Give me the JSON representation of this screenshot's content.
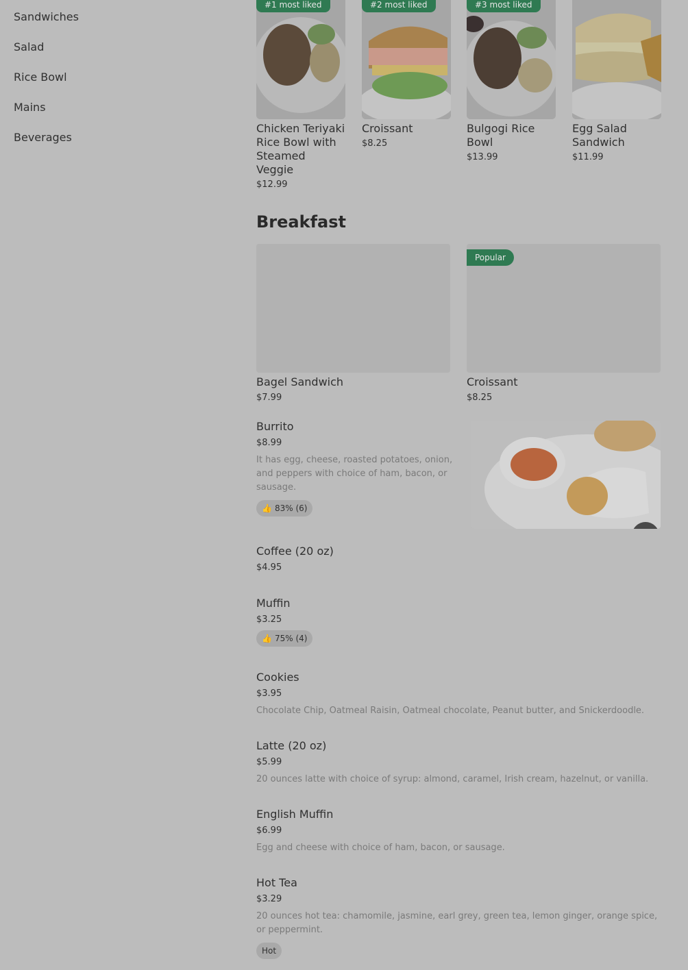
{
  "sidebar": {
    "items": [
      {
        "label": "Sandwiches"
      },
      {
        "label": "Salad"
      },
      {
        "label": "Rice Bowl"
      },
      {
        "label": "Mains"
      },
      {
        "label": "Beverages"
      }
    ]
  },
  "most_liked": [
    {
      "badge": "#1 most liked",
      "name": "Chicken Teriyaki Rice Bowl with Steamed Veggie",
      "price": "$12.99"
    },
    {
      "badge": "#2 most liked",
      "name": "Croissant",
      "price": "$8.25"
    },
    {
      "badge": "#3 most liked",
      "name": "Bulgogi Rice Bowl",
      "price": "$13.99"
    },
    {
      "badge": "",
      "name": "Egg Salad Sandwich",
      "price": "$11.99"
    }
  ],
  "breakfast": {
    "title": "Breakfast",
    "featured": [
      {
        "badge": "",
        "name": "Bagel Sandwich",
        "price": "$7.99"
      },
      {
        "badge": "Popular",
        "name": "Croissant",
        "price": "$8.25"
      }
    ],
    "items": [
      {
        "name": "Burrito",
        "price": "$8.99",
        "desc": "It has egg, cheese, roasted potatoes, onion, and peppers with choice of ham, bacon, or sausage.",
        "rating": "83% (6)"
      },
      {
        "name": "Coffee (20 oz)",
        "price": "$4.95"
      },
      {
        "name": "Muffin",
        "price": "$3.25",
        "rating": "75% (4)"
      },
      {
        "name": "Cookies",
        "price": "$3.95",
        "desc": "Chocolate Chip, Oatmeal Raisin, Oatmeal chocolate, Peanut butter, and Snickerdoodle."
      },
      {
        "name": "Latte (20 oz)",
        "price": "$5.99",
        "desc": "20 ounces latte with choice of syrup: almond, caramel, Irish cream, hazelnut, or vanilla."
      },
      {
        "name": "English Muffin",
        "price": "$6.99",
        "desc": "Egg and cheese with choice of ham, bacon, or sausage."
      },
      {
        "name": "Hot Tea",
        "price": "$3.29",
        "desc": "20 ounces hot tea: chamomile, jasmine, earl grey, green tea, lemon ginger, orange spice, or peppermint.",
        "tag": "Hot"
      }
    ]
  },
  "colors": {
    "badge_green": "#2f7a52",
    "overlay_bg": "#bcbcbc"
  }
}
